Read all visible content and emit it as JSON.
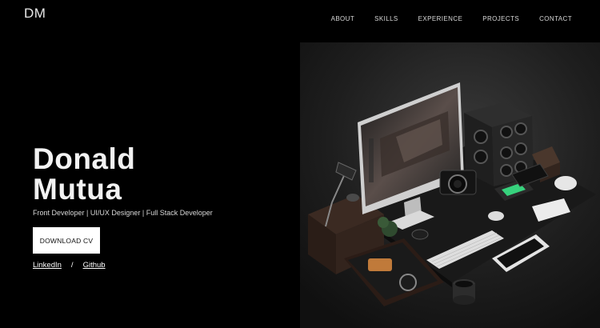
{
  "brand": {
    "logo": "DM"
  },
  "nav": {
    "items": [
      {
        "label": "ABOUT"
      },
      {
        "label": "SKILLS"
      },
      {
        "label": "EXPERIENCE"
      },
      {
        "label": "PROJECTS"
      },
      {
        "label": "CONTACT"
      }
    ]
  },
  "hero": {
    "name_line1": "Donald",
    "name_line2": "Mutua",
    "tagline": "Front Developer | UI/UX Designer | Full Stack Developer",
    "download_label": "DOWNLOAD CV",
    "links": {
      "linkedin": "LinkedIn",
      "separator": "/",
      "github": "Github"
    }
  },
  "colors": {
    "background": "#000000",
    "text": "#ffffff",
    "button_bg": "#ffffff",
    "button_text": "#111111"
  }
}
